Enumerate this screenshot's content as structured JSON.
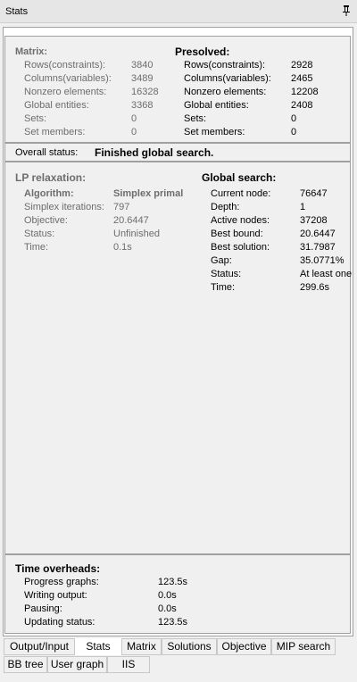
{
  "window": {
    "title": "Stats"
  },
  "matrix": {
    "heading": "Matrix:",
    "rows": [
      {
        "label": "Rows(constraints):",
        "value": "3840"
      },
      {
        "label": "Columns(variables):",
        "value": "3489"
      },
      {
        "label": "Nonzero elements:",
        "value": "16328"
      },
      {
        "label": "Global entities:",
        "value": "3368"
      },
      {
        "label": "Sets:",
        "value": "0"
      },
      {
        "label": "Set members:",
        "value": "0"
      }
    ]
  },
  "presolved": {
    "heading": "Presolved:",
    "rows": [
      {
        "label": "Rows(constraints):",
        "value": "2928"
      },
      {
        "label": "Columns(variables):",
        "value": "2465"
      },
      {
        "label": "Nonzero elements:",
        "value": "12208"
      },
      {
        "label": "Global entities:",
        "value": "2408"
      },
      {
        "label": "Sets:",
        "value": "0"
      },
      {
        "label": "Set members:",
        "value": "0"
      }
    ]
  },
  "overall": {
    "label": "Overall status:",
    "value": "Finished global search."
  },
  "lp": {
    "heading": "LP relaxation:",
    "algorithm_label": "Algorithm:",
    "algorithm_value": "Simplex primal",
    "rows": [
      {
        "label": "Simplex iterations:",
        "value": "797"
      },
      {
        "label": "Objective:",
        "value": "20.6447"
      },
      {
        "label": "Status:",
        "value": "Unfinished"
      },
      {
        "label": "Time:",
        "value": "0.1s"
      }
    ]
  },
  "global_search": {
    "heading": "Global search:",
    "rows": [
      {
        "label": "Current node:",
        "value": "76647"
      },
      {
        "label": "Depth:",
        "value": "1"
      },
      {
        "label": "Active nodes:",
        "value": "37208"
      },
      {
        "label": "Best bound:",
        "value": "20.6447"
      },
      {
        "label": "Best solution:",
        "value": "31.7987"
      },
      {
        "label": "Gap:",
        "value": "35.0771%"
      },
      {
        "label": "Status:",
        "value": "At least one"
      },
      {
        "label": "Time:",
        "value": "299.6s"
      }
    ]
  },
  "overheads": {
    "heading": "Time overheads:",
    "rows": [
      {
        "label": "Progress graphs:",
        "value": "123.5s"
      },
      {
        "label": "Writing output:",
        "value": "0.0s"
      },
      {
        "label": "Pausing:",
        "value": "0.0s"
      },
      {
        "label": "Updating status:",
        "value": "123.5s"
      }
    ]
  },
  "tabs": {
    "row1": [
      "Output/Input",
      "Stats",
      "Matrix",
      "Solutions",
      "Objective",
      "MIP search"
    ],
    "row2": [
      "BB tree",
      "User graph",
      "IIS"
    ],
    "active": "Stats"
  },
  "icons": {
    "pin": "pin-icon"
  }
}
